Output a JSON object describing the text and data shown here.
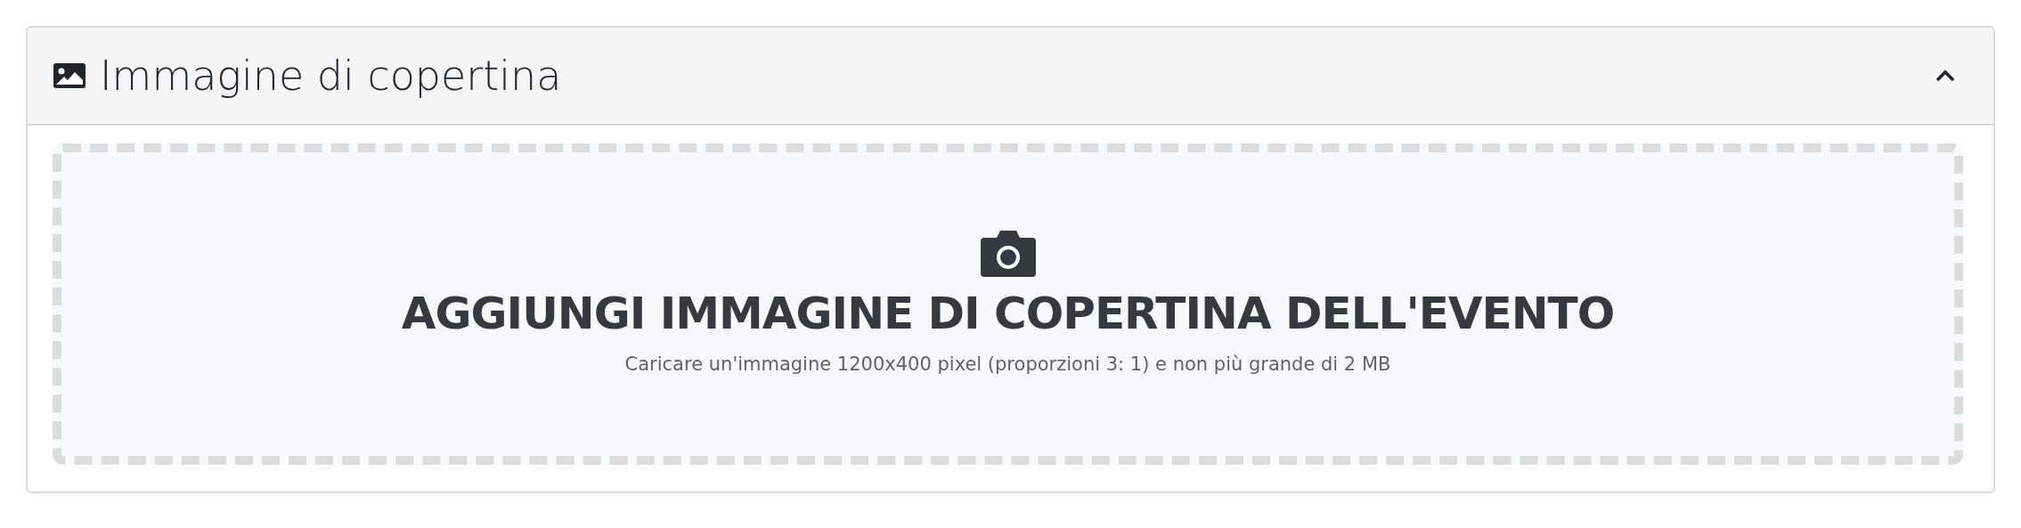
{
  "panel": {
    "title": "Immagine di copertina",
    "expanded": true
  },
  "dropzone": {
    "heading": "AGGIUNGI IMMAGINE DI COPERTINA DELL'EVENTO",
    "hint": "Caricare un'immagine 1200x400 pixel (proporzioni 3: 1) e non più grande di 2 MB"
  }
}
